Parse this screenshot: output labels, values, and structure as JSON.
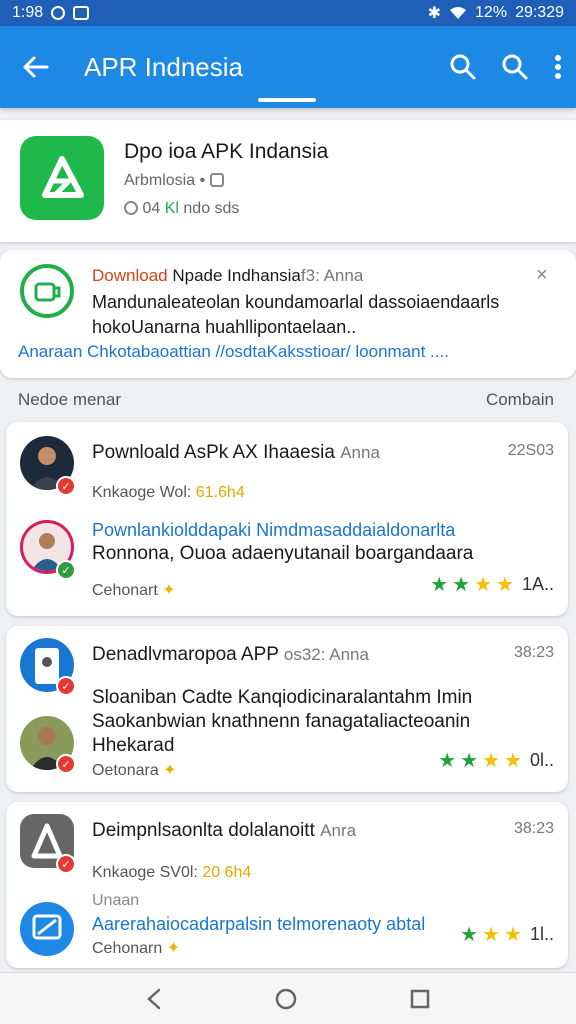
{
  "status_bar": {
    "time": "1:98",
    "battery": "12%",
    "clock": "29:329"
  },
  "app_bar": {
    "title": "APR Indnesia"
  },
  "app_card": {
    "name": "Dpo ioa APK Indansia",
    "developer": "Arbmlosia •",
    "stat_prefix": "04",
    "stat_highlight": "Kl",
    "stat_suffix": "ndo sds"
  },
  "notification": {
    "title_highlight": "Download",
    "title_rest": " Npade Indhansia",
    "title_meta": "f3: Anna",
    "close": "×",
    "body": "Mandunaleateolan koundamoarlal dassoiaendaarls hokoUanarna huahllipontaelaan..",
    "link": "Anaraan Chkotabaoattian //osdtaKaksstioar/ loonmant ...."
  },
  "section": {
    "left": "Nedoe menar",
    "right": "Combain"
  },
  "posts": [
    {
      "title": "Pownloald AsPk AX Ihaaesia",
      "meta": "Anna",
      "time": "22S03",
      "sub_label": "Knkaoge Wol:",
      "sub_value": "61.6h4",
      "link": "Pownlankiolddapaki Nimdmasaddaialdonarlta",
      "text_lines": [
        "Ronnona, Ouoa adaenyutanail boargandaara"
      ],
      "foot": "Cehonart",
      "count": "1А.."
    },
    {
      "title": "Denadlvmaropoa APP",
      "meta": "os32: Anna",
      "time": "38:23",
      "text_lines": [
        "Sloaniban Cadte Kanqiodicinaralantahm Imin",
        "Saokanbwian knathnenn fanagataliacteoanin",
        "Hhekarad"
      ],
      "foot": "Oetonara",
      "count": "0l.."
    },
    {
      "title": "Deimpnlsaonlta dolalanoitt",
      "meta": "Anra",
      "time": "38:23",
      "sub_label": "Knkaoge SV0l:",
      "sub_value": "20 6h4",
      "sub2": "Unaan",
      "link": "Aarerahaiocadarpalsin telmorenaoty abtal",
      "foot": "Cehonarn",
      "count": "1l.."
    }
  ],
  "colors": {
    "app_bar": "#1e88e5",
    "status_bar": "#1f5fb8",
    "accent_green": "#1fb84b",
    "link_blue": "#1976d2"
  }
}
